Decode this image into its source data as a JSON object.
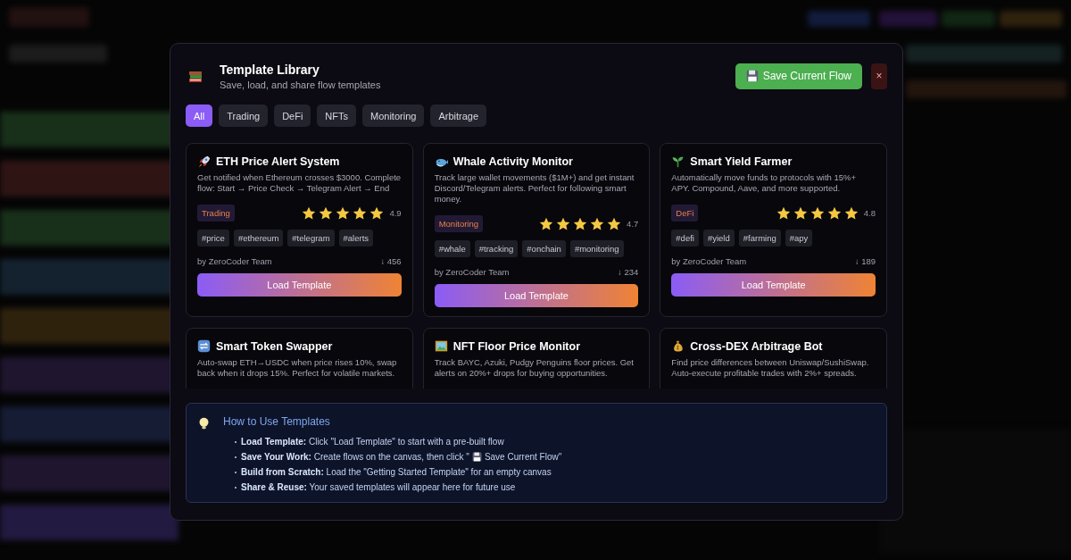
{
  "dialog": {
    "title": "Template Library",
    "subtitle": "Save, load, and share flow templates",
    "save_button": "Save Current Flow",
    "close_button": "×"
  },
  "tabs": [
    {
      "label": "All",
      "selected": true
    },
    {
      "label": "Trading",
      "selected": false
    },
    {
      "label": "DeFi",
      "selected": false
    },
    {
      "label": "NFTs",
      "selected": false
    },
    {
      "label": "Monitoring",
      "selected": false
    },
    {
      "label": "Arbitrage",
      "selected": false
    }
  ],
  "templates": [
    {
      "title": "ETH Price Alert System",
      "description": "Get notified when Ethereum crosses $3000. Complete flow: Start → Price Check → Telegram Alert → End",
      "category": "Trading",
      "stars": 5,
      "rating": "4.9",
      "tags": [
        "#price",
        "#ethereum",
        "#telegram",
        "#alerts"
      ],
      "author": "by ZeroCoder Team",
      "downloads": "↓ 456",
      "button": "Load Template"
    },
    {
      "title": "Whale Activity Monitor",
      "description": "Track large wallet movements ($1M+) and get instant Discord/Telegram alerts. Perfect for following smart money.",
      "category": "Monitoring",
      "stars": 5,
      "rating": "4.7",
      "tags": [
        "#whale",
        "#tracking",
        "#onchain",
        "#monitoring"
      ],
      "author": "by ZeroCoder Team",
      "downloads": "↓ 234",
      "button": "Load Template"
    },
    {
      "title": "Smart Yield Farmer",
      "description": "Automatically move funds to protocols with 15%+ APY. Compound, Aave, and more supported.",
      "category": "DeFi",
      "stars": 5,
      "rating": "4.8",
      "tags": [
        "#defi",
        "#yield",
        "#farming",
        "#apy"
      ],
      "author": "by ZeroCoder Team",
      "downloads": "↓ 189",
      "button": "Load Template"
    },
    {
      "title": "Smart Token Swapper",
      "description": "Auto-swap ETH→USDC when price rises 10%, swap back when it drops 15%. Perfect for volatile markets."
    },
    {
      "title": "NFT Floor Price Monitor",
      "description": "Track BAYC, Azuki, Pudgy Penguins floor prices. Get alerts on 20%+ drops for buying opportunities."
    },
    {
      "title": "Cross-DEX Arbitrage Bot",
      "description": "Find price differences between Uniswap/SushiSwap. Auto-execute profitable trades with 2%+ spreads."
    }
  ],
  "help": {
    "title": "How to Use Templates",
    "items": [
      {
        "text": "**Load Template:** Click \"Load Template\" to start with a pre-built flow"
      },
      {
        "text": "**Save Your Work:** Create flows on the canvas, then click \"",
        "after": "Save Current Flow\""
      },
      {
        "text": "**Build from Scratch:** Load the \"Getting Started Template\" for an empty canvas"
      },
      {
        "text": "**Share & Reuse:** Your saved templates will appear here for future use"
      }
    ]
  }
}
